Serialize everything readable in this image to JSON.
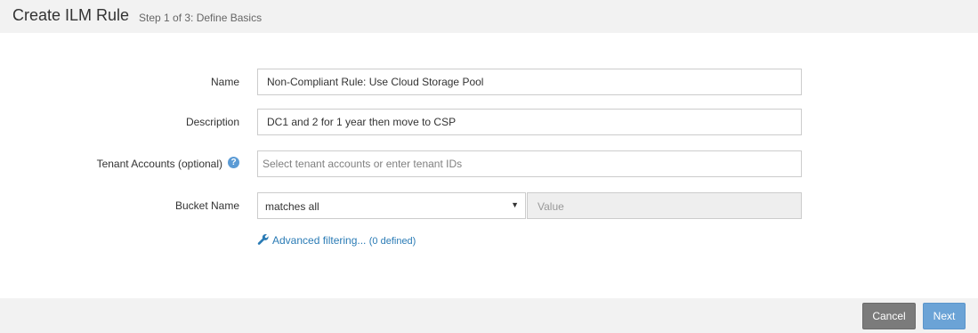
{
  "header": {
    "title": "Create ILM Rule",
    "subtitle": "Step 1 of 3: Define Basics"
  },
  "form": {
    "name": {
      "label": "Name",
      "value": "Non-Compliant Rule: Use Cloud Storage Pool"
    },
    "description": {
      "label": "Description",
      "value": "DC1 and 2 for 1 year then move to CSP"
    },
    "tenant_accounts": {
      "label": "Tenant Accounts (optional)",
      "placeholder": "Select tenant accounts or enter tenant IDs",
      "help_icon": "question-circle-icon",
      "help_glyph": "?"
    },
    "bucket_name": {
      "label": "Bucket Name",
      "operator": "matches all",
      "dropdown_arrow": "▼",
      "value_placeholder": "Value"
    },
    "advanced_filtering": {
      "icon": "wrench-icon",
      "label": "Advanced filtering...",
      "count": "(0 defined)"
    }
  },
  "footer": {
    "cancel_label": "Cancel",
    "next_label": "Next"
  },
  "colors": {
    "header_bg": "#f2f2f2",
    "link": "#2a7bb5",
    "help_icon": "#5b9bd5",
    "cancel_button": "#7b7b7b",
    "next_button": "#6ba3d6"
  }
}
